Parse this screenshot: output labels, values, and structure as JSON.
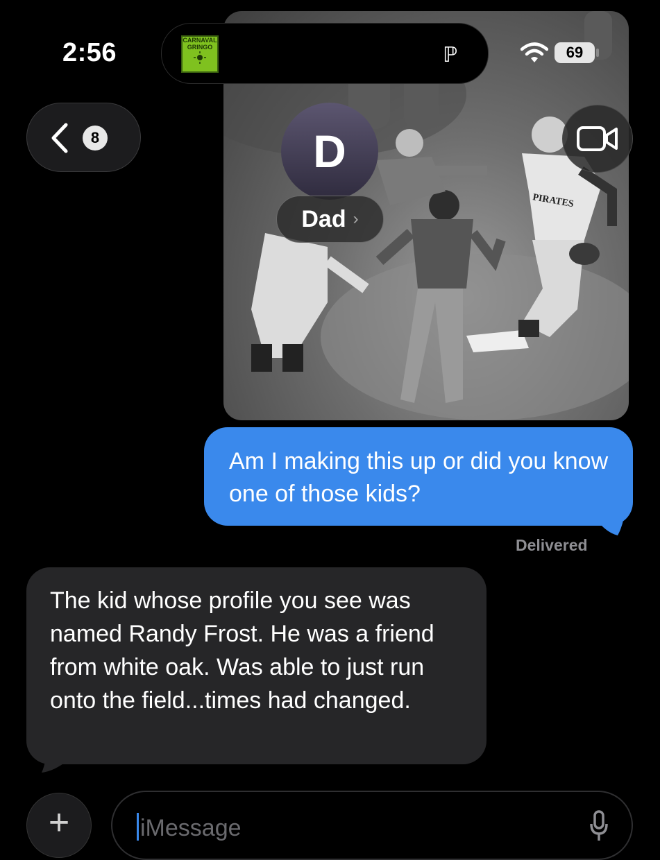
{
  "status_bar": {
    "time": "2:56",
    "battery_level": "69",
    "wifi_icon": "wifi-icon",
    "now_playing": {
      "album_art_title_line1": "CARNAVAL",
      "album_art_title_line2": "GRINGO",
      "glyph": "ℙ"
    }
  },
  "nav": {
    "back_icon": "chevron-left-icon",
    "unread_count": "8",
    "contact_initial": "D",
    "contact_name": "Dad",
    "video_icon": "video-camera-icon"
  },
  "photo": {
    "jersey_text": "PIRATES"
  },
  "messages": [
    {
      "direction": "sent",
      "text": "Am I making this up or did you know one of those kids?",
      "status": "Delivered"
    },
    {
      "direction": "received",
      "text": "The kid whose profile you see was named Randy Frost. He was a friend from white oak. Was able to just run onto the field...times had changed."
    }
  ],
  "compose": {
    "placeholder": "iMessage",
    "plus_icon": "plus-icon",
    "mic_icon": "microphone-icon"
  },
  "colors": {
    "sent_bubble": "#3a89ec",
    "received_bubble": "#262628",
    "background": "#000000"
  }
}
